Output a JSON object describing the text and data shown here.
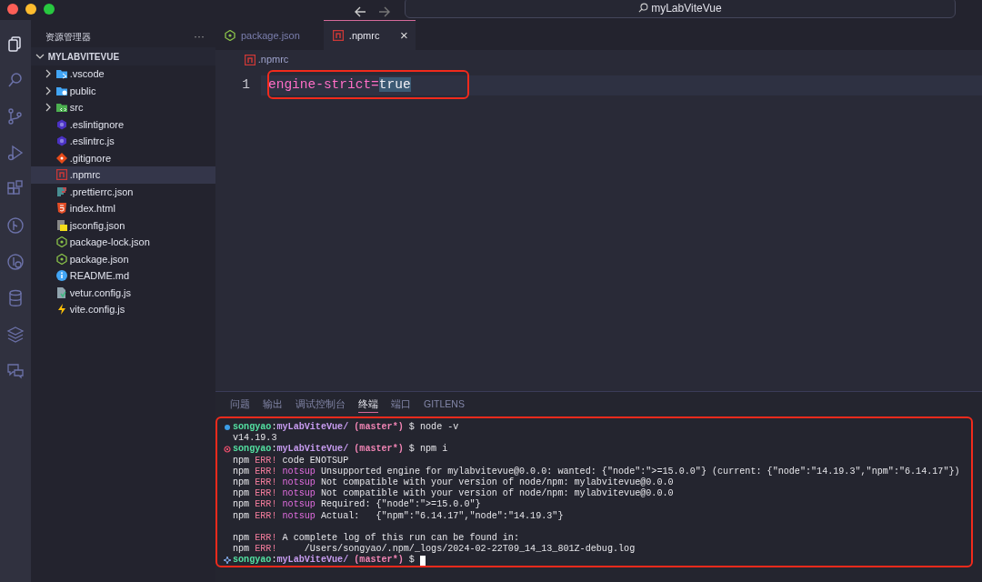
{
  "window": {
    "search": "myLabViteVue"
  },
  "activity_bar": [
    {
      "kind": "explorer",
      "selected": true
    },
    {
      "kind": "search",
      "selected": false
    },
    {
      "kind": "source-control",
      "selected": false
    },
    {
      "kind": "run",
      "selected": false
    },
    {
      "kind": "extensions",
      "selected": false
    },
    {
      "kind": "git-graph",
      "selected": false
    },
    {
      "kind": "remote",
      "selected": false
    },
    {
      "kind": "database",
      "selected": false
    },
    {
      "kind": "layers",
      "selected": false
    },
    {
      "kind": "chat",
      "selected": false
    }
  ],
  "sidebar": {
    "title": "资源管理器",
    "more": "···",
    "project": {
      "name": "MYLABVITEVUE",
      "expanded": true
    },
    "items": [
      {
        "name": ".vscode",
        "kind": "vscode-folder",
        "expanded": false,
        "selected": false
      },
      {
        "name": "public",
        "kind": "public-folder",
        "expanded": false,
        "selected": false
      },
      {
        "name": "src",
        "kind": "src-folder",
        "expanded": false,
        "selected": false
      },
      {
        "name": ".eslintignore",
        "kind": "eslint",
        "selected": false
      },
      {
        "name": ".eslintrc.js",
        "kind": "eslint",
        "selected": false
      },
      {
        "name": ".gitignore",
        "kind": "git",
        "selected": false
      },
      {
        "name": ".npmrc",
        "kind": "npm",
        "selected": true
      },
      {
        "name": ".prettierrc.json",
        "kind": "prettier",
        "selected": false
      },
      {
        "name": "index.html",
        "kind": "html",
        "selected": false
      },
      {
        "name": "jsconfig.json",
        "kind": "jsconfig",
        "selected": false
      },
      {
        "name": "package-lock.json",
        "kind": "node",
        "selected": false
      },
      {
        "name": "package.json",
        "kind": "node",
        "selected": false
      },
      {
        "name": "README.md",
        "kind": "info",
        "selected": false
      },
      {
        "name": "vetur.config.js",
        "kind": "vetur",
        "selected": false
      },
      {
        "name": "vite.config.js",
        "kind": "vite",
        "selected": false
      }
    ]
  },
  "tabs": [
    {
      "label": "package.json",
      "kind": "node",
      "selected": false
    },
    {
      "label": ".npmrc",
      "kind": "npm",
      "selected": true,
      "close": "×"
    }
  ],
  "breadcrumb": {
    "label": ".npmrc",
    "kind": "npm"
  },
  "editor": {
    "highlighted": true,
    "lines": [
      {
        "number": "1",
        "segments": [
          {
            "text": "engine-strict=",
            "kind": "key",
            "selected": false
          },
          {
            "text": "true",
            "kind": "value",
            "selected": true
          }
        ]
      }
    ]
  },
  "panel_tabs": [
    {
      "label": "问题",
      "selected": false
    },
    {
      "label": "输出",
      "selected": false
    },
    {
      "label": "调试控制台",
      "selected": false
    },
    {
      "label": "终端",
      "selected": true
    },
    {
      "label": "端口",
      "selected": false
    },
    {
      "label": "GITLENS",
      "selected": false
    }
  ],
  "terminal": {
    "highlighted": true,
    "lines": [
      {
        "kind": "success",
        "segments": [
          {
            "text": "songyao",
            "kind": "user"
          },
          {
            "text": ":",
            "kind": "plain"
          },
          {
            "text": "myLabViteVue/",
            "kind": "path"
          },
          {
            "text": " (master*)",
            "kind": "branch"
          },
          {
            "text": " $ node -v",
            "kind": "plain"
          }
        ]
      },
      {
        "kind": "output",
        "segments": [
          {
            "text": "v14.19.3",
            "kind": "plain"
          }
        ]
      },
      {
        "kind": "error",
        "segments": [
          {
            "text": "songyao",
            "kind": "user"
          },
          {
            "text": ":",
            "kind": "plain"
          },
          {
            "text": "myLabViteVue/",
            "kind": "path"
          },
          {
            "text": " (master*)",
            "kind": "branch"
          },
          {
            "text": " $ npm i",
            "kind": "plain"
          }
        ]
      },
      {
        "kind": "output",
        "segments": [
          {
            "text": "npm ",
            "kind": "plain"
          },
          {
            "text": "ERR!",
            "kind": "err"
          },
          {
            "text": " code ENOTSUP",
            "kind": "plain"
          }
        ]
      },
      {
        "kind": "output",
        "segments": [
          {
            "text": "npm ",
            "kind": "plain"
          },
          {
            "text": "ERR!",
            "kind": "err"
          },
          {
            "text": " notsup",
            "kind": "notsup"
          },
          {
            "text": " Unsupported engine for mylabvitevue@0.0.0: wanted: {\"node\":\">=15.0.0\"} (current: {\"node\":\"14.19.3\",\"npm\":\"6.14.17\"})",
            "kind": "plain"
          }
        ]
      },
      {
        "kind": "output",
        "segments": [
          {
            "text": "npm ",
            "kind": "plain"
          },
          {
            "text": "ERR!",
            "kind": "err"
          },
          {
            "text": " notsup",
            "kind": "notsup"
          },
          {
            "text": " Not compatible with your version of node/npm: mylabvitevue@0.0.0",
            "kind": "plain"
          }
        ]
      },
      {
        "kind": "output",
        "segments": [
          {
            "text": "npm ",
            "kind": "plain"
          },
          {
            "text": "ERR!",
            "kind": "err"
          },
          {
            "text": " notsup",
            "kind": "notsup"
          },
          {
            "text": " Not compatible with your version of node/npm: mylabvitevue@0.0.0",
            "kind": "plain"
          }
        ]
      },
      {
        "kind": "output",
        "segments": [
          {
            "text": "npm ",
            "kind": "plain"
          },
          {
            "text": "ERR!",
            "kind": "err"
          },
          {
            "text": " notsup",
            "kind": "notsup"
          },
          {
            "text": " Required: {\"node\":\">=15.0.0\"}",
            "kind": "plain"
          }
        ]
      },
      {
        "kind": "output",
        "segments": [
          {
            "text": "npm ",
            "kind": "plain"
          },
          {
            "text": "ERR!",
            "kind": "err"
          },
          {
            "text": " notsup",
            "kind": "notsup"
          },
          {
            "text": " Actual:   {\"npm\":\"6.14.17\",\"node\":\"14.19.3\"}",
            "kind": "plain"
          }
        ]
      },
      {
        "kind": "blank"
      },
      {
        "kind": "output",
        "segments": [
          {
            "text": "npm ",
            "kind": "plain"
          },
          {
            "text": "ERR!",
            "kind": "err"
          },
          {
            "text": " A complete log of this run can be found in:",
            "kind": "plain"
          }
        ]
      },
      {
        "kind": "output",
        "segments": [
          {
            "text": "npm ",
            "kind": "plain"
          },
          {
            "text": "ERR!",
            "kind": "err"
          },
          {
            "text": "     /Users/songyao/.npm/_logs/2024-02-22T09_14_13_801Z-debug.log",
            "kind": "plain"
          }
        ]
      },
      {
        "kind": "ready",
        "cursor": true,
        "segments": [
          {
            "text": "songyao",
            "kind": "user"
          },
          {
            "text": ":",
            "kind": "plain"
          },
          {
            "text": "myLabViteVue/",
            "kind": "path"
          },
          {
            "text": " (master*)",
            "kind": "branch"
          },
          {
            "text": " $",
            "kind": "plain"
          }
        ]
      }
    ]
  }
}
